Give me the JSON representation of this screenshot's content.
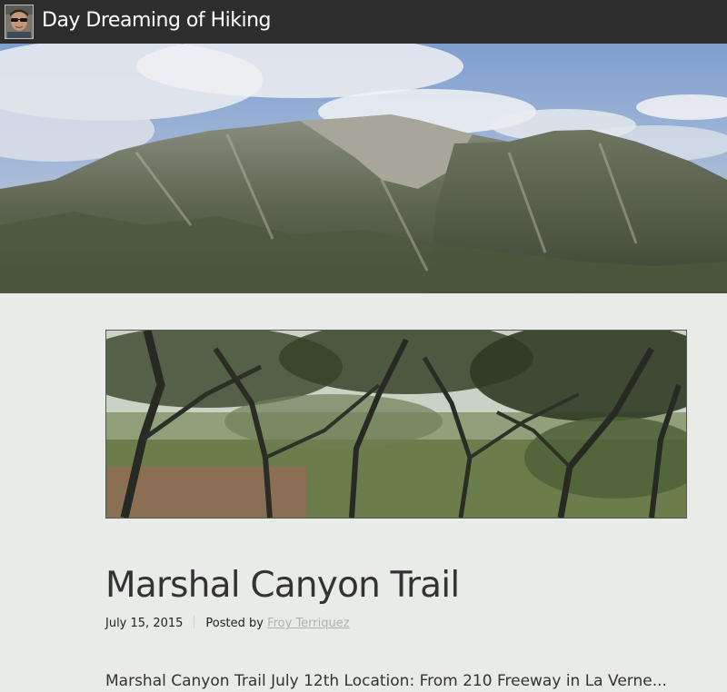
{
  "header": {
    "site_title": "Day Dreaming of Hiking",
    "avatar_icon": "user-avatar-icon",
    "background_color": "#2d2d2d"
  },
  "hero": {
    "description_icon": "mountain-landscape-image"
  },
  "post": {
    "featured_image_icon": "oak-forest-image",
    "title": "Marshal Canyon Trail",
    "date": "July 15, 2015",
    "posted_by_label": "Posted by",
    "author": "Froy Terriquez",
    "excerpt": "Marshal Canyon Trail July 12th Location: From 210 Freeway in La Verne..."
  },
  "colors": {
    "page_background": "#e9ebe8",
    "title_text": "#333333",
    "author_link": "#b0b2af"
  }
}
